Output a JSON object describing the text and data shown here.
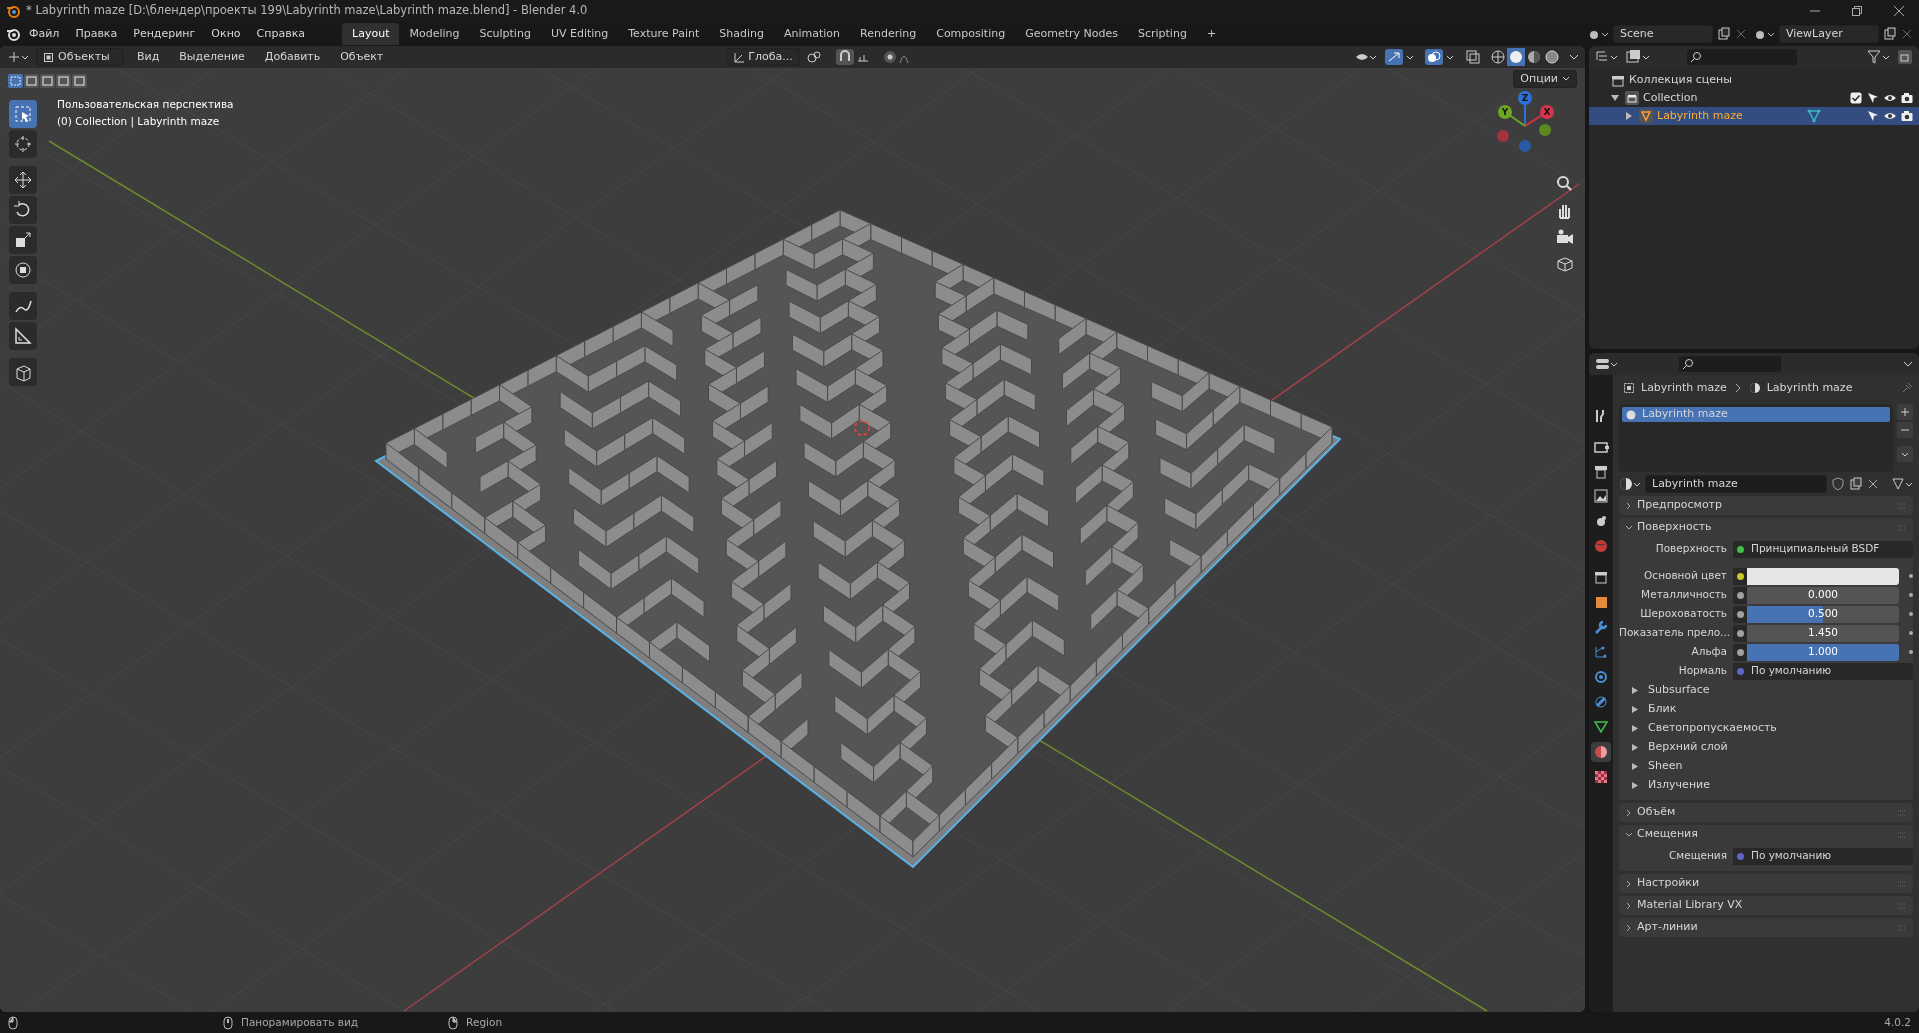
{
  "window": {
    "title": "* Labyrinth maze [D:\\блендер\\проекты 199\\Labyrinth maze\\Labyrinth maze.blend] - Blender 4.0"
  },
  "menu": [
    "Файл",
    "Правка",
    "Рендеринг",
    "Окно",
    "Справка"
  ],
  "workspaces": [
    {
      "label": "Layout",
      "selected": true
    },
    {
      "label": "Modeling",
      "selected": false
    },
    {
      "label": "Sculpting",
      "selected": false
    },
    {
      "label": "UV Editing",
      "selected": false
    },
    {
      "label": "Texture Paint",
      "selected": false
    },
    {
      "label": "Shading",
      "selected": false
    },
    {
      "label": "Animation",
      "selected": false
    },
    {
      "label": "Rendering",
      "selected": false
    },
    {
      "label": "Compositing",
      "selected": false
    },
    {
      "label": "Geometry Nodes",
      "selected": false
    },
    {
      "label": "Scripting",
      "selected": false
    }
  ],
  "add_workspace": "+",
  "scene": "Scene",
  "view_layer": "ViewLayer",
  "viewport": {
    "mode": "Объекты",
    "menus": [
      "Вид",
      "Выделение",
      "Добавить",
      "Объект"
    ],
    "orientation": "Глоба...",
    "options": "Опции",
    "shading": [
      {
        "selected": false
      },
      {
        "selected": true
      },
      {
        "selected": false
      },
      {
        "selected": false
      }
    ],
    "overlay_lines": [
      "Пользовательская перспектива",
      "(0) Collection | Labyrinth maze"
    ],
    "tools": [
      {
        "kind": "select",
        "selected": true
      },
      {
        "kind": "cursor",
        "selected": false
      },
      {
        "kind": "move",
        "selected": false
      },
      {
        "kind": "rotate",
        "selected": false
      },
      {
        "kind": "scale",
        "selected": false
      },
      {
        "kind": "transform",
        "selected": false
      },
      {
        "kind": "annotate",
        "selected": false
      },
      {
        "kind": "measure",
        "selected": false
      },
      {
        "kind": "add",
        "selected": false
      }
    ],
    "gizmo": [
      "Z",
      "Y",
      "X"
    ]
  },
  "outliner": {
    "items": [
      {
        "label": "Коллекция сцены",
        "kind": "scene",
        "selected": false,
        "children": [
          {
            "label": "Collection",
            "kind": "collection",
            "selected": false,
            "expanded": true,
            "checked": true,
            "children": [
              {
                "label": "Labyrinth maze",
                "kind": "object",
                "selected": true,
                "expanded": false
              }
            ]
          }
        ]
      }
    ]
  },
  "properties": {
    "tabs": [
      {
        "kind": "tool",
        "selected": false
      },
      {
        "kind": "render",
        "selected": false
      },
      {
        "kind": "output",
        "selected": false
      },
      {
        "kind": "view",
        "selected": false
      },
      {
        "kind": "scene",
        "selected": false
      },
      {
        "kind": "world",
        "selected": false
      },
      {
        "kind": "collection",
        "selected": false
      },
      {
        "kind": "object",
        "selected": false
      },
      {
        "kind": "modifier",
        "selected": false
      },
      {
        "kind": "particles",
        "selected": false
      },
      {
        "kind": "physics",
        "selected": false
      },
      {
        "kind": "constraint",
        "selected": false
      },
      {
        "kind": "data",
        "selected": false
      },
      {
        "kind": "material",
        "selected": true
      },
      {
        "kind": "texture",
        "selected": false
      }
    ],
    "breadcrumb": [
      "Labyrinth maze",
      "Labyrinth maze"
    ],
    "slots": [
      {
        "label": "Labyrinth maze",
        "selected": true
      }
    ],
    "material": "Labyrinth maze",
    "panels": [
      {
        "title": "Предпросмотр",
        "expanded": false
      },
      {
        "title": "Поверхность",
        "expanded": true,
        "rows": [
          {
            "kind": "socket",
            "label": "Поверхность",
            "value": "Принципиальный BSDF",
            "color": "#3fbf4a"
          },
          {
            "kind": "swatch",
            "label": "Основной цвет",
            "color": "#c7c729"
          },
          {
            "kind": "slider",
            "label": "Металличность",
            "value": "0.000",
            "level": 0,
            "color": "#a1a1a1"
          },
          {
            "kind": "slider",
            "label": "Шероховатость",
            "value": "0.500",
            "level": 0.5,
            "color": "#a1a1a1"
          },
          {
            "kind": "number",
            "label": "Показатель прело...",
            "value": "1.450",
            "color": "#a1a1a1"
          },
          {
            "kind": "slider",
            "label": "Альфа",
            "value": "1.000",
            "level": 1,
            "color": "#a1a1a1"
          },
          {
            "kind": "socket",
            "label": "Нормаль",
            "value": "По умолчанию",
            "color": "#6363c7"
          }
        ],
        "subpanels": [
          {
            "label": "Subsurface",
            "expanded": false
          },
          {
            "label": "Блик",
            "expanded": false
          },
          {
            "label": "Светопропускаемость",
            "expanded": false
          },
          {
            "label": "Верхний слой",
            "expanded": false
          },
          {
            "label": "Sheen",
            "expanded": false
          },
          {
            "label": "Излучение",
            "expanded": false
          }
        ]
      },
      {
        "title": "Объём",
        "expanded": false
      },
      {
        "title": "Смещения",
        "expanded": true,
        "rows": [
          {
            "kind": "socket",
            "label": "Смещения",
            "value": "По умолчанию",
            "color": "#6363c7"
          }
        ]
      },
      {
        "title": "Настройки",
        "expanded": false
      },
      {
        "title": "Material Library VX",
        "expanded": false
      },
      {
        "title": "Арт-линии",
        "expanded": false
      }
    ]
  },
  "status": {
    "hints": [
      "Панорамировать вид",
      "Region"
    ],
    "version": "4.0.2"
  }
}
